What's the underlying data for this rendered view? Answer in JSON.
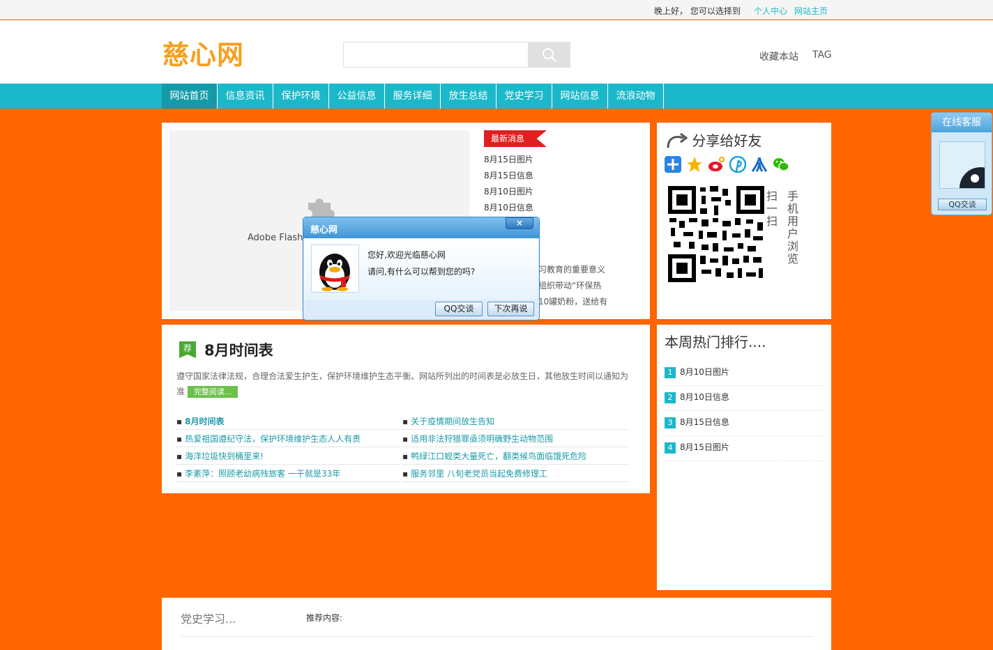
{
  "topbar": {
    "greeting": "晚上好，  您可以选择到",
    "user_center": "个人中心",
    "site_home": "网站主页"
  },
  "header": {
    "logo": "慈心网",
    "search": {
      "placeholder": ""
    },
    "search_icon": "search-icon",
    "bookmark": "收藏本站",
    "tag": "TAG"
  },
  "nav": {
    "items": [
      "网站首页",
      "信息资讯",
      "保护环境",
      "公益信息",
      "服务详细",
      "放生总结",
      "党史学习",
      "网站信息",
      "流浪动物"
    ],
    "active": "网站首页"
  },
  "flash": {
    "text": "Adobe Flash",
    "icon": "puzzle-plugin-icon"
  },
  "latest": {
    "tag": "最新消息",
    "items": [
      "8月15日图片",
      "8月15日信息",
      "8月10日图片",
      "8月10日信息"
    ],
    "partial_texts": [
      "学习教育的重要意义",
      "会组织带动“环保热",
      "送10罐奶粉，送给有"
    ]
  },
  "share": {
    "title": "分享给好友",
    "icons": [
      "plus-share-icon",
      "star-share-icon",
      "weibo-icon",
      "pinterest-icon",
      "renren-icon",
      "wechat-icon"
    ],
    "scan_text": "扫一扫",
    "mobile_text": "手机用户浏览"
  },
  "featured": {
    "badge": "荐",
    "title": "8月时间表",
    "desc": "遵守国家法律法规，合理合法爱生护生，保护环境维护生态平衡。网站所列出的时间表是必放生日，其他放生时间以通知为准",
    "read_more": "完整阅读...",
    "left_list": [
      "8月时间表",
      "热爱祖国遵纪守法，保护环境维护生态人人有责",
      "海洋垃圾快到桶里来!",
      "李素萍：照顾老幼病残旅客 一干就是33年"
    ],
    "right_list": [
      "关于疫情期间放生告知",
      "适用非法狩猎罪亟须明确野生动物范围",
      "鸭绿江口蚬类大量死亡，翻类候鸟面临饿死危险",
      "服务邻里 八旬老党员当起免费修理工"
    ]
  },
  "hot": {
    "title": "本周热门排行....",
    "items": [
      {
        "num": "1",
        "text": "8月10日图片"
      },
      {
        "num": "2",
        "text": "8月10日信息"
      },
      {
        "num": "3",
        "text": "8月15日信息"
      },
      {
        "num": "4",
        "text": "8月15日图片"
      }
    ]
  },
  "bottom": {
    "title": "党史学习...",
    "recommend": "推荐内容:"
  },
  "customer_service": {
    "title": "在线客服",
    "button": "QQ交谈",
    "avatar_icon": "qq-avatar-icon"
  },
  "popup": {
    "title": "慈心网",
    "close": "×",
    "line1": "您好,欢迎光临慈心网",
    "line2": "请问,有什么可以帮到您的吗?",
    "chat_button": "QQ交谈",
    "later_button": "下次再说",
    "avatar_icon": "qq-penguin-icon"
  },
  "colors": {
    "background": "#ff6600",
    "nav": "#1bb8c9",
    "nav_active": "#159aa8",
    "logo": "#f5a020",
    "news_tag": "#e02020",
    "featured_badge": "#4aa832",
    "link": "#1a9aa8"
  }
}
